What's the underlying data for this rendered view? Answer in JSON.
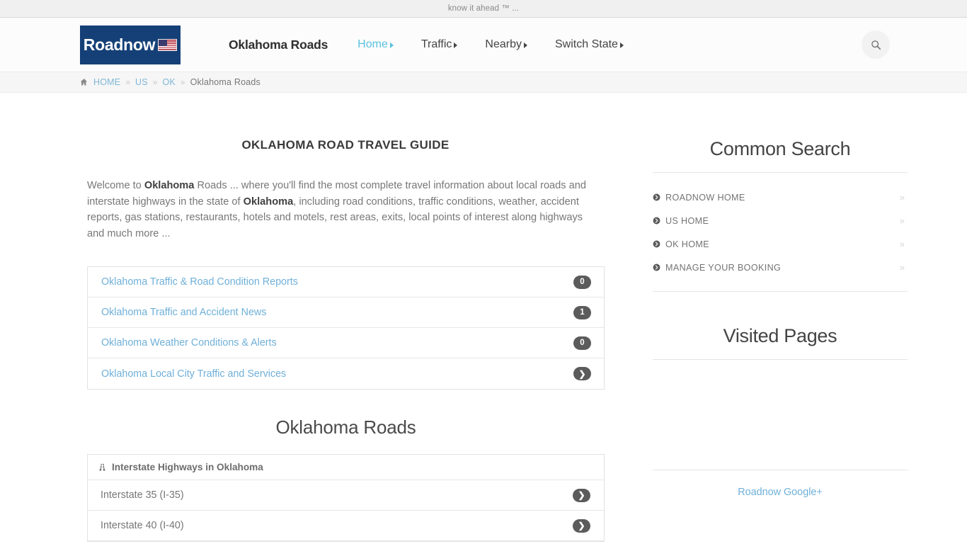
{
  "topbar": {
    "tagline": "know it ahead ™ ..."
  },
  "header": {
    "logo_text": "Roadnow",
    "logo_icon": "us-flag-icon",
    "site_title": "Oklahoma Roads",
    "search_icon": "search-icon",
    "nav": [
      {
        "label": "Home",
        "active": true,
        "caret": true
      },
      {
        "label": "Traffic",
        "active": false,
        "caret": true
      },
      {
        "label": "Nearby",
        "active": false,
        "caret": true
      },
      {
        "label": "Switch State",
        "active": false,
        "caret": true
      }
    ]
  },
  "breadcrumb": {
    "home_icon": "home-icon",
    "separator": "»",
    "items": [
      {
        "label": "HOME",
        "link": true
      },
      {
        "label": "US",
        "link": true
      },
      {
        "label": "OK",
        "link": true
      },
      {
        "label": "Oklahoma Roads",
        "link": false
      }
    ]
  },
  "main": {
    "page_title": "OKLAHOMA ROAD TRAVEL GUIDE",
    "intro": {
      "part1": "Welcome to ",
      "bold1": "Oklahoma",
      "part2": " Roads ... where you'll find the most complete travel information about local roads and interstate highways in the state of ",
      "bold2": "Oklahoma",
      "part3": ", including road conditions, traffic conditions, weather, accident reports, gas stations, restaurants, hotels and motels, rest areas, exits, local points of interest along highways and much more ..."
    },
    "quick_links": [
      {
        "label": "Oklahoma Traffic & Road Condition Reports",
        "badge": "0",
        "badge_type": "count"
      },
      {
        "label": "Oklahoma Traffic and Accident News",
        "badge": "1",
        "badge_type": "count"
      },
      {
        "label": "Oklahoma Weather Conditions & Alerts",
        "badge": "0",
        "badge_type": "count"
      },
      {
        "label": "Oklahoma Local City Traffic and Services",
        "badge": "❯",
        "badge_type": "chevron"
      }
    ],
    "roads_section": {
      "title": "Oklahoma Roads",
      "panel_header": "Interstate Highways in Oklahoma",
      "panel_header_icon": "road-icon",
      "rows": [
        {
          "label": "Interstate 35 (I-35)",
          "badge": "❯"
        },
        {
          "label": "Interstate 40 (I-40)",
          "badge": "❯"
        }
      ]
    }
  },
  "sidebar": {
    "common_search": {
      "title": "Common Search",
      "items": [
        {
          "label": "ROADNOW HOME",
          "bullet_icon": "chevron-circle-right-icon",
          "arrow": "»"
        },
        {
          "label": "US HOME",
          "bullet_icon": "chevron-circle-right-icon",
          "arrow": "»"
        },
        {
          "label": "OK HOME",
          "bullet_icon": "chevron-circle-right-icon",
          "arrow": "»"
        },
        {
          "label": "MANAGE YOUR BOOKING",
          "bullet_icon": "chevron-circle-right-icon",
          "arrow": "»"
        }
      ]
    },
    "visited_pages": {
      "title": "Visited Pages"
    },
    "gplus_link": "Roadnow Google+"
  },
  "colors": {
    "logo_bg": "#154077",
    "link_blue": "#6fb0d8",
    "nav_active": "#5bc0de",
    "badge_bg": "#5b5b5b",
    "body_text": "#777777"
  }
}
